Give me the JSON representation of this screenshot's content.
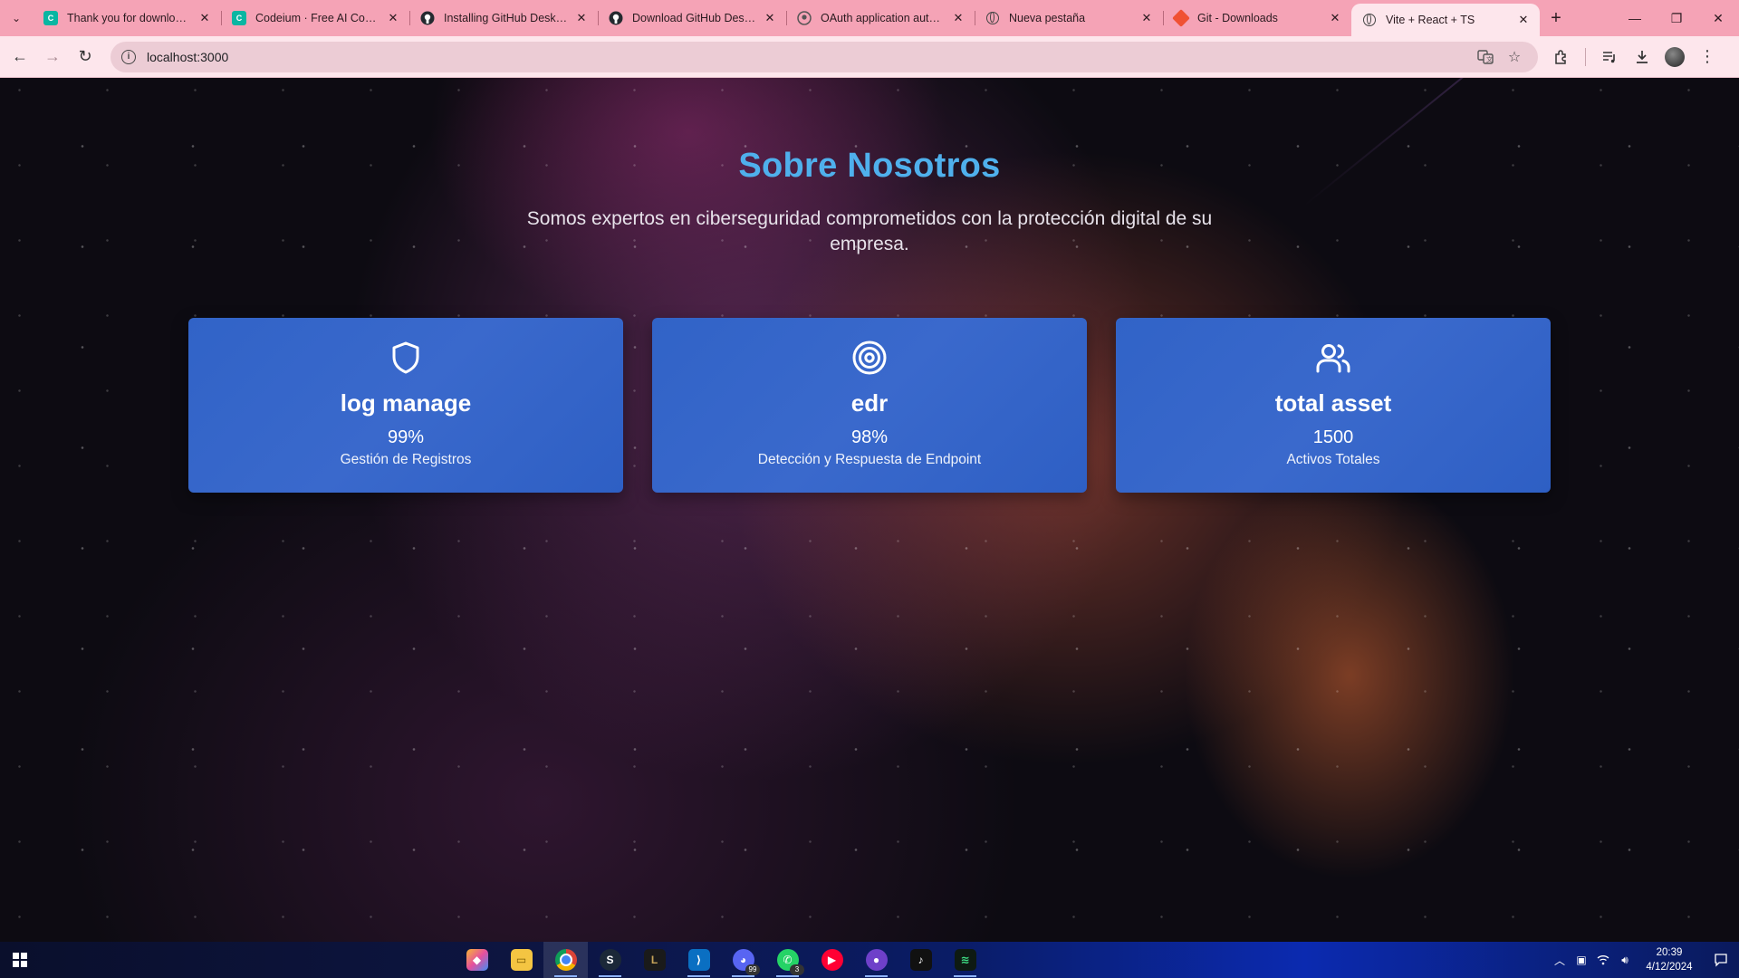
{
  "browser": {
    "tabs": [
      {
        "title": "Thank you for downloading",
        "favicon": "codeium-icon"
      },
      {
        "title": "Codeium · Free AI Code Completion",
        "favicon": "codeium-icon"
      },
      {
        "title": "Installing GitHub Desktop",
        "favicon": "github-icon"
      },
      {
        "title": "Download GitHub Desktop",
        "favicon": "github-icon"
      },
      {
        "title": "OAuth application authorized",
        "favicon": "github-icon"
      },
      {
        "title": "Nueva pestaña",
        "favicon": "chrome-globe-icon"
      },
      {
        "title": "Git - Downloads",
        "favicon": "git-icon"
      },
      {
        "title": "Vite + React + TS",
        "favicon": "globe-icon",
        "active": true
      }
    ],
    "url": "localhost:3000"
  },
  "page": {
    "title": "Sobre Nosotros",
    "subtitle": "Somos expertos en ciberseguridad comprometidos con la protección digital de su empresa.",
    "accent_color": "#4fb0ec",
    "card_color": "#3465c8",
    "cards": [
      {
        "icon": "shield-icon",
        "title": "log manage",
        "value": "99%",
        "description": "Gestión de Registros"
      },
      {
        "icon": "target-icon",
        "title": "edr",
        "value": "98%",
        "description": "Detección y Respuesta de Endpoint"
      },
      {
        "icon": "users-icon",
        "title": "total asset",
        "value": "1500",
        "description": "Activos Totales"
      }
    ]
  },
  "taskbar": {
    "apps": [
      "copilot-icon",
      "file-explorer-icon",
      "chrome-icon",
      "steam-icon",
      "league-icon",
      "vscode-icon",
      "discord-icon",
      "whatsapp-icon",
      "youtube-music-icon",
      "github-desktop-icon",
      "tiktok-icon",
      "app-icon"
    ],
    "discord_badge": "99",
    "whatsapp_badge": "3",
    "time": "20:39",
    "date": "4/12/2024"
  }
}
